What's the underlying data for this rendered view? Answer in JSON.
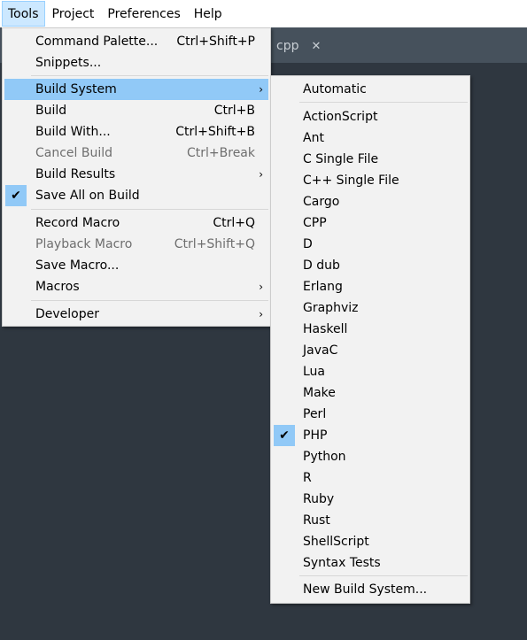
{
  "menubar": {
    "items": [
      "Tools",
      "Project",
      "Preferences",
      "Help"
    ]
  },
  "tab": {
    "label": "cpp",
    "close": "✕"
  },
  "tools_menu": {
    "items": [
      {
        "label": "Command Palette...",
        "shortcut": "Ctrl+Shift+P"
      },
      {
        "label": "Snippets...",
        "shortcut": ""
      },
      {
        "label": "Build System",
        "shortcut": "",
        "submenu": true
      },
      {
        "label": "Build",
        "shortcut": "Ctrl+B"
      },
      {
        "label": "Build With...",
        "shortcut": "Ctrl+Shift+B"
      },
      {
        "label": "Cancel Build",
        "shortcut": "Ctrl+Break"
      },
      {
        "label": "Build Results",
        "shortcut": "",
        "submenu": true
      },
      {
        "label": "Save All on Build",
        "shortcut": "",
        "checked": true
      },
      {
        "label": "Record Macro",
        "shortcut": "Ctrl+Q"
      },
      {
        "label": "Playback Macro",
        "shortcut": "Ctrl+Shift+Q"
      },
      {
        "label": "Save Macro...",
        "shortcut": ""
      },
      {
        "label": "Macros",
        "shortcut": "",
        "submenu": true
      },
      {
        "label": "Developer",
        "shortcut": "",
        "submenu": true
      }
    ],
    "submenu_arrow": "›",
    "check_mark": "✔"
  },
  "build_menu": {
    "automatic": "Automatic",
    "systems": [
      "ActionScript",
      "Ant",
      "C Single File",
      "C++ Single File",
      "Cargo",
      "CPP",
      "D",
      "D dub",
      "Erlang",
      "Graphviz",
      "Haskell",
      "JavaC",
      "Lua",
      "Make",
      "Perl",
      "PHP",
      "Python",
      "R",
      "Ruby",
      "Rust",
      "ShellScript",
      "Syntax Tests"
    ],
    "selected": "PHP",
    "new": "New Build System..."
  },
  "colors": {
    "highlight": "#91c9f7",
    "menubar_active": "#cce8ff",
    "editor_bg": "#2f3740"
  }
}
